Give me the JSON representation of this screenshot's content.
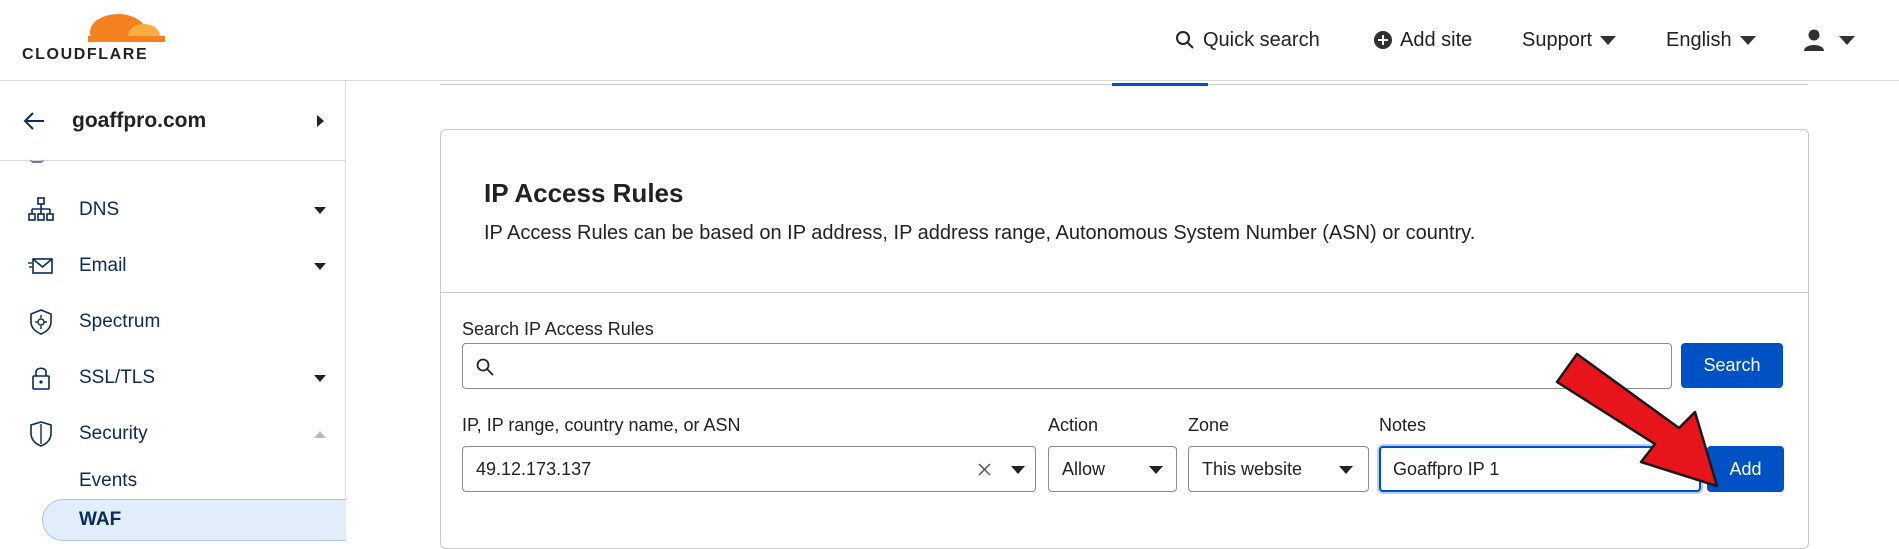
{
  "header": {
    "logo_text": "CLOUDFLARE",
    "quick_search": "Quick search",
    "add_site": "Add site",
    "support": "Support",
    "language": "English"
  },
  "sidebar": {
    "site_name": "goaffpro.com",
    "items": [
      {
        "label": "DNS",
        "icon": "sitemap-icon",
        "expandable": true
      },
      {
        "label": "Email",
        "icon": "email-icon",
        "expandable": true
      },
      {
        "label": "Spectrum",
        "icon": "spectrum-icon",
        "expandable": false
      },
      {
        "label": "SSL/TLS",
        "icon": "lock-icon",
        "expandable": true
      },
      {
        "label": "Security",
        "icon": "shield-icon",
        "expanded": true
      }
    ],
    "sub_items": [
      {
        "label": "Events",
        "active": false
      },
      {
        "label": "WAF",
        "active": true
      }
    ]
  },
  "card": {
    "title": "IP Access Rules",
    "description": "IP Access Rules can be based on IP address, IP address range, Autonomous System Number (ASN) or country.",
    "search": {
      "label": "Search IP Access Rules",
      "value": "",
      "button": "Search"
    },
    "form": {
      "ip_label": "IP, IP range, country name, or ASN",
      "ip_value": "49.12.173.137",
      "action_label": "Action",
      "action_value": "Allow",
      "zone_label": "Zone",
      "zone_value": "This website",
      "notes_label": "Notes",
      "notes_value": "Goaffpro IP 1",
      "add_button": "Add"
    }
  },
  "colors": {
    "accent": "#0051c3",
    "brand_orange": "#f48120",
    "annotation_arrow": "#e8141c"
  }
}
